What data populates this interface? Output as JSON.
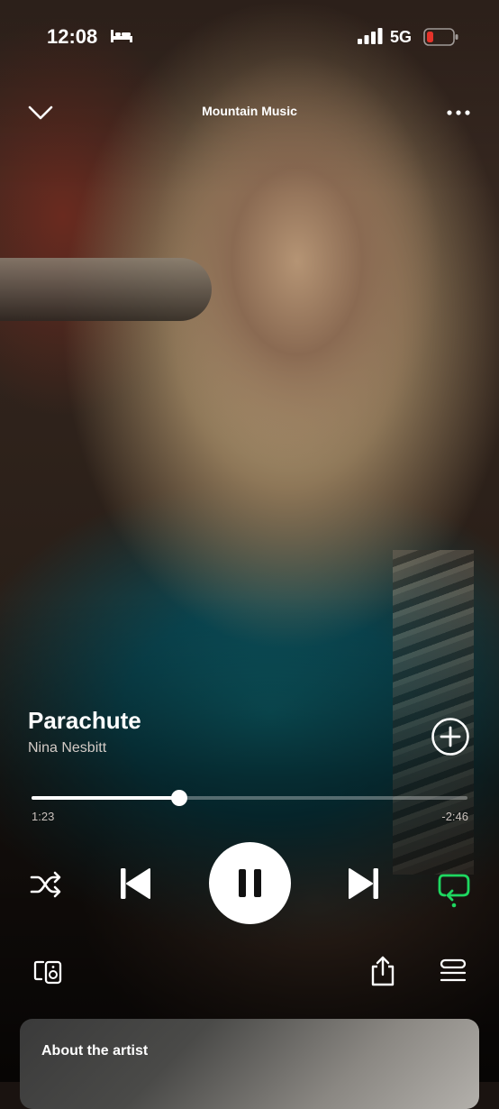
{
  "status_bar": {
    "time": "12:08",
    "network": "5G",
    "icons": [
      "bed-icon",
      "signal-icon",
      "battery-low-icon"
    ],
    "battery_color": "#e5332a"
  },
  "header": {
    "title": "Mountain Music",
    "left_icon": "chevron-down-icon",
    "right_icon": "more-icon"
  },
  "track": {
    "title": "Parachute",
    "artist": "Nina Nesbitt",
    "add_icon": "add-circle-icon"
  },
  "progress": {
    "elapsed": "1:23",
    "remaining": "-2:46",
    "fraction": 0.339
  },
  "controls": {
    "icons": [
      "shuffle-icon",
      "previous-icon",
      "pause-icon",
      "next-icon",
      "repeat-icon"
    ],
    "repeat_active": true,
    "accent_color": "#1ed760"
  },
  "bottom_actions": {
    "icons": [
      "devices-icon",
      "share-icon",
      "queue-icon"
    ]
  },
  "about_card": {
    "title": "About the artist"
  }
}
